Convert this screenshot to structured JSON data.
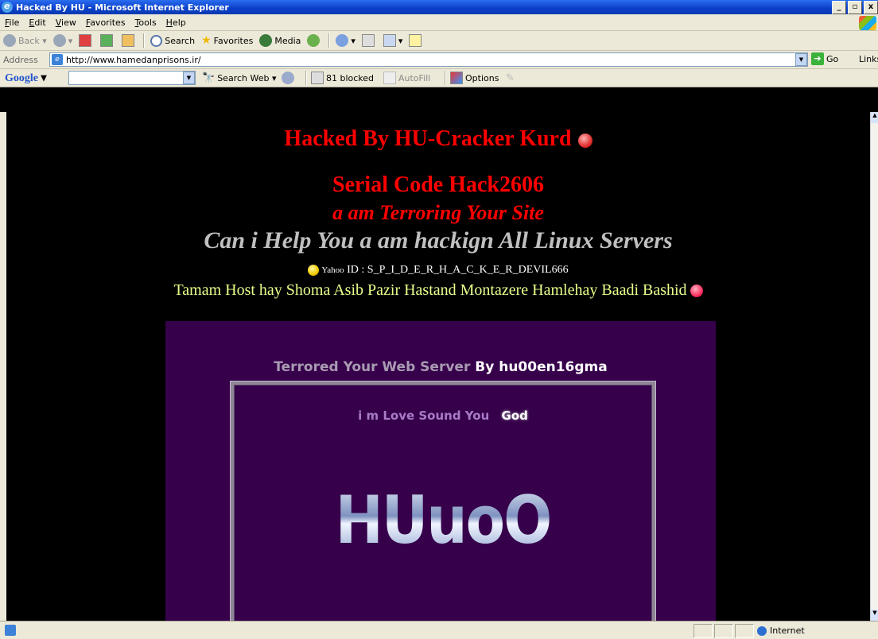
{
  "window": {
    "title": "Hacked By HU - Microsoft Internet Explorer",
    "btn_min": "_",
    "btn_max": "▫",
    "btn_close": "x"
  },
  "menu": {
    "items": [
      "File",
      "Edit",
      "View",
      "Favorites",
      "Tools",
      "Help"
    ]
  },
  "toolbar": {
    "back": "Back",
    "search": "Search",
    "favorites": "Favorites",
    "media": "Media"
  },
  "address": {
    "label": "Address",
    "url": "http://www.hamedanprisons.ir/",
    "go": "Go",
    "links": "Links"
  },
  "google_bar": {
    "logo": "Google",
    "search_web": "Search Web",
    "blocked": "81 blocked",
    "autofill": "AutoFill",
    "options": "Options"
  },
  "page": {
    "headline1": "Hacked By HU-Cracker Kurd",
    "headline2": "Serial Code Hack2606",
    "headline3": "a am Terroring Your Site",
    "headline4": "Can i Help You a am hackign All Linux Servers",
    "yahoo_prefix": "Yahoo",
    "yahoo_id": "ID : S_P_I_D_E_R_H_A_C_K_E_R_DEVIL666",
    "tamam": "Tamam Host hay Shoma Asib Pazir Hastand Montazere Hamlehay Baadi Bashid",
    "terrored_prefix": "Terrored Your Web Server",
    "terrored_by": "By hu00en16gma",
    "love": "i m Love Sound You",
    "god": "God",
    "logo_text": "HUuoO"
  },
  "status": {
    "zone": "Internet"
  },
  "colors": {
    "page_bg": "#000000",
    "headline": "#ff0000",
    "tamam": "#e7ff8a",
    "panel": "#36004b"
  }
}
